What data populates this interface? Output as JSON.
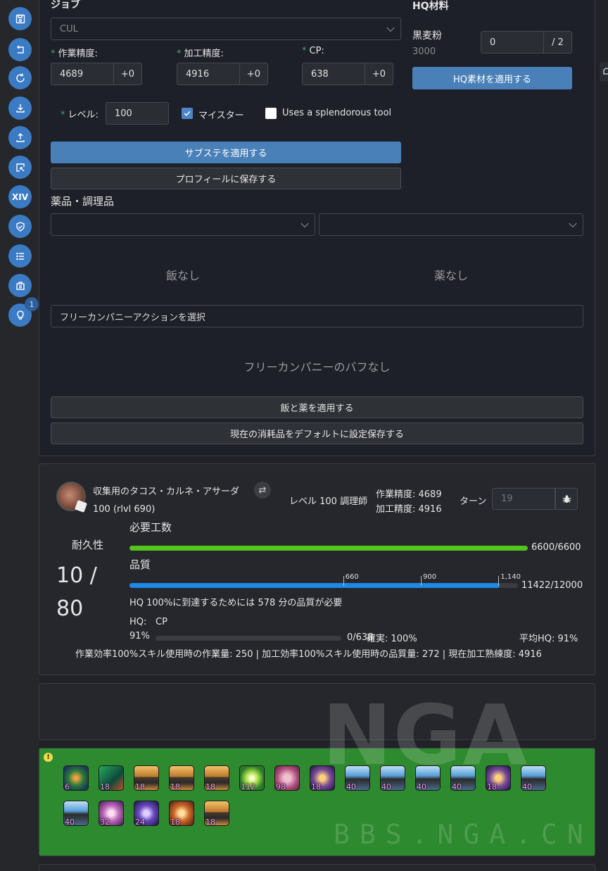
{
  "sidebar": {
    "xiv_label": "XIV",
    "tips_badge": "1"
  },
  "job": {
    "heading": "ジョブ",
    "selected": "CUL",
    "craftsmanship_label": "作業精度:",
    "craftsmanship": "4689",
    "craftsmanship_bonus": "+0",
    "control_label": "加工精度:",
    "control": "4916",
    "control_bonus": "+0",
    "cp_label": "CP:",
    "cp": "638",
    "cp_bonus": "+0",
    "level_label": "レベル:",
    "level": "100",
    "meister_label": "マイスター",
    "meister_checked": true,
    "splendorous_label": "Uses a splendorous tool",
    "splendorous_checked": false,
    "apply_substats": "サブステを適用する",
    "save_profile": "プロフィールに保存する"
  },
  "hq": {
    "heading": "HQ材料",
    "item_name": "黒麦粉",
    "item_quality": "3000",
    "hq_count": "0",
    "hq_max": "/ 2",
    "apply_button": "HQ素材を適用する"
  },
  "consumables": {
    "heading": "薬品・調理品",
    "food_none": "飯なし",
    "medicine_none": "薬なし",
    "fc_placeholder": "フリーカンパニーアクションを選択",
    "fc_none": "フリーカンパニーのバフなし",
    "apply_button": "飯と薬を適用する",
    "save_default": "現在の消耗品をデフォルトに設定保存する"
  },
  "simulation": {
    "recipe_name": "収集用のタコス・カルネ・アサーダ",
    "recipe_level": "100 (rlvl 690)",
    "crafter": "レベル 100 調理師",
    "craftsmanship": "作業精度: 4689",
    "control": "加工精度: 4916",
    "turn_label": "ターン",
    "turn_value": "19",
    "durability_label": "耐久性",
    "durability_value": "10 /",
    "durability_max": "80",
    "progress_label": "必要工数",
    "progress_text": "6600/6600",
    "progress_fraction": 1.0,
    "quality_label": "品質",
    "quality_text": "11422/12000",
    "quality_fraction": 0.952,
    "quality_markers": [
      {
        "label": "660",
        "fraction": 0.55
      },
      {
        "label": "900",
        "fraction": 0.75
      },
      {
        "label": "1,140",
        "fraction": 0.95
      }
    ],
    "hq_needed": "HQ 100%に到達するためには 578 分の品質が必要",
    "hq_label": "HQ:",
    "cp_label": "CP",
    "hq_percent": "91%",
    "cp_text": "0/638",
    "cp_fraction": 0.0,
    "certainty": "確実: 100%",
    "avg_hq": "平均HQ: 91%",
    "footer": "作業効率100%スキル使用時の作業量: 250 | 加工効率100%スキル使用時の品質量: 272 | 現在加工熟練度: 4916"
  },
  "rotation": {
    "colors": {
      "background": "#2e8a2e"
    },
    "skills": [
      {
        "icon": "muscle-memory-icon",
        "count": "6"
      },
      {
        "icon": "veneration-icon",
        "count": "18"
      },
      {
        "icon": "pan-icon",
        "count": "18"
      },
      {
        "icon": "pan-icon",
        "count": "18"
      },
      {
        "icon": "pan-icon",
        "count": "18"
      },
      {
        "icon": "innovation-icon",
        "count": "112"
      },
      {
        "icon": "great-strides-icon",
        "count": "98"
      },
      {
        "icon": "hand-touch-icon",
        "count": "18"
      },
      {
        "icon": "pan-blue-icon",
        "count": "40"
      },
      {
        "icon": "pan-blue-icon",
        "count": "40"
      },
      {
        "icon": "pan-blue-icon",
        "count": "40"
      },
      {
        "icon": "pan-blue-icon",
        "count": "40"
      },
      {
        "icon": "hand-touch-icon",
        "count": "18"
      },
      {
        "icon": "pan-blue-icon",
        "count": "40"
      },
      {
        "icon": "pan-blue-icon",
        "count": "40"
      },
      {
        "icon": "manipulation-icon",
        "count": "32"
      },
      {
        "icon": "byregots-icon",
        "count": "24"
      },
      {
        "icon": "hands-icon",
        "count": "18"
      },
      {
        "icon": "pan-icon",
        "count": "18"
      }
    ]
  },
  "watermark": {
    "logo": "NGA",
    "url": "BBS.NGA.CN"
  }
}
